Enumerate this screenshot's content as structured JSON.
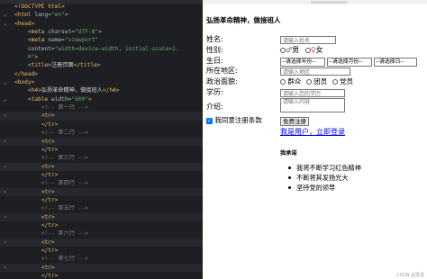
{
  "editor": {
    "lines": [
      {
        "fold": "",
        "parts": [
          [
            "tag",
            "<!DOCTYPE html>"
          ]
        ]
      },
      {
        "fold": "⌄",
        "parts": [
          [
            "tag",
            "<html "
          ],
          [
            "att",
            "lang="
          ],
          [
            "str",
            "\"en\""
          ],
          [
            "tag",
            ">"
          ]
        ]
      },
      {
        "fold": "⌄",
        "parts": [
          [
            "tag",
            "<head>"
          ]
        ]
      },
      {
        "fold": "",
        "parts": [
          [
            "txt",
            "    "
          ],
          [
            "tag",
            "<meta "
          ],
          [
            "att",
            "charset="
          ],
          [
            "str",
            "\"UTF-8\""
          ],
          [
            "tag",
            ">"
          ]
        ]
      },
      {
        "fold": "",
        "parts": [
          [
            "txt",
            "    "
          ],
          [
            "tag",
            "<meta "
          ],
          [
            "att",
            "name="
          ],
          [
            "str",
            "\"viewport\""
          ]
        ]
      },
      {
        "fold": "",
        "parts": [
          [
            "txt",
            "    "
          ],
          [
            "att",
            "content="
          ],
          [
            "str",
            "\"width=device-width, initial-scale=1."
          ]
        ]
      },
      {
        "fold": "",
        "parts": [
          [
            "str",
            "    0\""
          ],
          [
            "tag",
            ">"
          ]
        ]
      },
      {
        "fold": "",
        "parts": [
          [
            "txt",
            "    "
          ],
          [
            "tag",
            "<title>"
          ],
          [
            "txt",
            "注册页面"
          ],
          [
            "tag",
            "</title>"
          ]
        ]
      },
      {
        "fold": "",
        "parts": [
          [
            "tag",
            "</head>"
          ]
        ]
      },
      {
        "fold": "⌄",
        "parts": [
          [
            "tag",
            "<body>"
          ]
        ]
      },
      {
        "fold": "",
        "parts": [
          [
            "txt",
            "    "
          ],
          [
            "tag",
            "<h4>"
          ],
          [
            "txt",
            "弘扬革命精神，做接班人"
          ],
          [
            "tag",
            "</h4>"
          ]
        ]
      },
      {
        "fold": "⌄",
        "parts": [
          [
            "txt",
            "    "
          ],
          [
            "tag",
            "<table "
          ],
          [
            "att",
            "width="
          ],
          [
            "str",
            "\"600\""
          ],
          [
            "tag",
            ">"
          ]
        ]
      },
      {
        "fold": "",
        "parts": [
          [
            "cmt",
            "        <!-- 第一行 -->"
          ]
        ]
      },
      {
        "fold": "›",
        "parts": [
          [
            "txt",
            "        "
          ],
          [
            "tag",
            "<tr>"
          ]
        ]
      },
      {
        "fold": "",
        "parts": [
          [
            "txt",
            "        "
          ],
          [
            "tag",
            "</tr>"
          ]
        ]
      },
      {
        "fold": "",
        "parts": [
          [
            "cmt",
            "        <!-- 第二行 -->"
          ]
        ]
      },
      {
        "fold": "›",
        "parts": [
          [
            "txt",
            "        "
          ],
          [
            "tag",
            "<tr>"
          ]
        ]
      },
      {
        "fold": "",
        "parts": [
          [
            "txt",
            "        "
          ],
          [
            "tag",
            "</tr>"
          ]
        ]
      },
      {
        "fold": "",
        "parts": [
          [
            "cmt",
            "        <!-- 第三行 -->"
          ]
        ]
      },
      {
        "fold": "›",
        "parts": [
          [
            "txt",
            "        "
          ],
          [
            "tag",
            "<tr>"
          ]
        ]
      },
      {
        "fold": "",
        "parts": [
          [
            "txt",
            "        "
          ],
          [
            "tag",
            "</tr>"
          ]
        ]
      },
      {
        "fold": "",
        "parts": [
          [
            "cmt",
            "        <!-- 第四行 -->"
          ]
        ]
      },
      {
        "fold": "›",
        "parts": [
          [
            "txt",
            "        "
          ],
          [
            "tag",
            "<tr>"
          ]
        ]
      },
      {
        "fold": "",
        "parts": [
          [
            "txt",
            "        "
          ],
          [
            "tag",
            "</tr>"
          ]
        ]
      },
      {
        "fold": "",
        "parts": [
          [
            "cmt",
            "        <!-- 第五行 -->"
          ]
        ]
      },
      {
        "fold": "›",
        "parts": [
          [
            "txt",
            "        "
          ],
          [
            "tag",
            "<tr>"
          ]
        ]
      },
      {
        "fold": "",
        "parts": [
          [
            "txt",
            "        "
          ],
          [
            "tag",
            "</tr>"
          ]
        ]
      },
      {
        "fold": "",
        "parts": [
          [
            "cmt",
            "        <!-- 第六行 -->"
          ]
        ]
      },
      {
        "fold": "›",
        "parts": [
          [
            "txt",
            "        "
          ],
          [
            "tag",
            "<tr>"
          ]
        ]
      },
      {
        "fold": "",
        "parts": [
          [
            "txt",
            "        "
          ],
          [
            "tag",
            "</tr>"
          ]
        ]
      },
      {
        "fold": "",
        "parts": [
          [
            "cmt",
            "        <!-- 第七行 -->"
          ]
        ]
      },
      {
        "fold": "›",
        "parts": [
          [
            "txt",
            "        "
          ],
          [
            "tag",
            "<tr>"
          ]
        ]
      },
      {
        "fold": "",
        "parts": [
          [
            "txt",
            "        "
          ],
          [
            "tag",
            "</tr>"
          ]
        ]
      }
    ]
  },
  "preview": {
    "title": "弘扬革命精神，做接班人",
    "labels": {
      "name": "姓名:",
      "gender": "性别:",
      "birthday": "生日:",
      "region": "所在地区:",
      "politics": "政治面貌:",
      "education": "学历:",
      "intro": "介绍:"
    },
    "placeholders": {
      "name": "请输入姓名",
      "region": "请输入地区",
      "education": "请输入您的学历",
      "intro": "请输入内容"
    },
    "gender_options": [
      "男",
      "女"
    ],
    "birthday_selects": [
      "--请选择年份--",
      "--请选择月份--",
      "--请选择日--"
    ],
    "politics_options": [
      "群众",
      "团员",
      "党员"
    ],
    "agree_label": "我同意注册条款",
    "register_button": "免费注册",
    "login_link": "我是用户，立即登录",
    "promise_title": "我承诺",
    "promises": [
      "我将不断学习红色精神",
      "不断将其发扬光大",
      "坚持党的领导"
    ],
    "watermark": "CSDN @雷蛋"
  }
}
